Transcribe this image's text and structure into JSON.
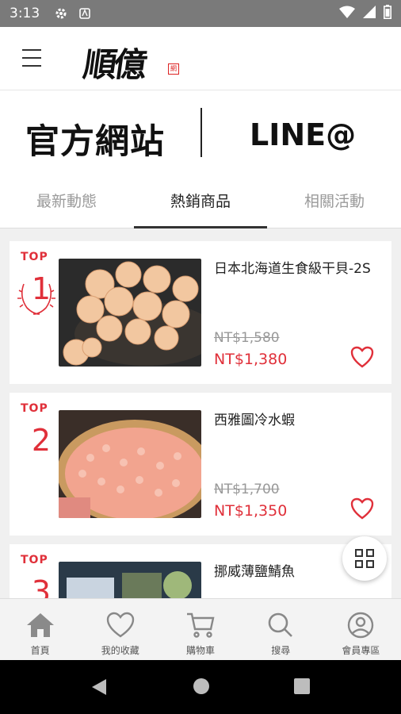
{
  "status_bar": {
    "time": "3:13"
  },
  "header": {
    "logo_text": "順億",
    "seal_text": "網"
  },
  "hero": {
    "left_label": "官方網站",
    "right_label": "LINE@"
  },
  "tabs": [
    {
      "label": "最新動態",
      "active": false
    },
    {
      "label": "熱銷商品",
      "active": true
    },
    {
      "label": "相關活動",
      "active": false
    }
  ],
  "products": [
    {
      "top_label": "TOP",
      "rank": "1",
      "name": "日本北海道生食級干貝-2S",
      "original_price": "NT$1,580",
      "price": "NT$1,380"
    },
    {
      "top_label": "TOP",
      "rank": "2",
      "name": "西雅圖冷水蝦",
      "original_price": "NT$1,700",
      "price": "NT$1,350"
    },
    {
      "top_label": "TOP",
      "rank": "3",
      "name": "挪威薄鹽鯖魚",
      "original_price": "",
      "price": ""
    }
  ],
  "bottom_nav": [
    {
      "label": "首頁",
      "icon": "home-icon"
    },
    {
      "label": "我的收藏",
      "icon": "heart-icon"
    },
    {
      "label": "購物車",
      "icon": "cart-icon"
    },
    {
      "label": "搜尋",
      "icon": "search-icon"
    },
    {
      "label": "會員專區",
      "icon": "user-icon"
    }
  ],
  "colors": {
    "accent": "#e0303a",
    "text": "#222222",
    "muted": "#9a9a9a"
  }
}
